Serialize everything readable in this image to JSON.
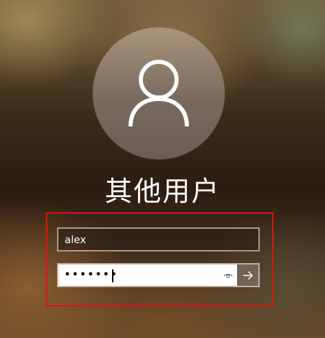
{
  "account": {
    "display_name": "其他用户"
  },
  "form": {
    "username_value": "alex",
    "password_mask": "•••••••"
  },
  "icons": {
    "avatar": "user-icon",
    "reveal": "eye-icon",
    "submit": "arrow-right-icon"
  },
  "colors": {
    "highlight_box": "#e01212"
  }
}
